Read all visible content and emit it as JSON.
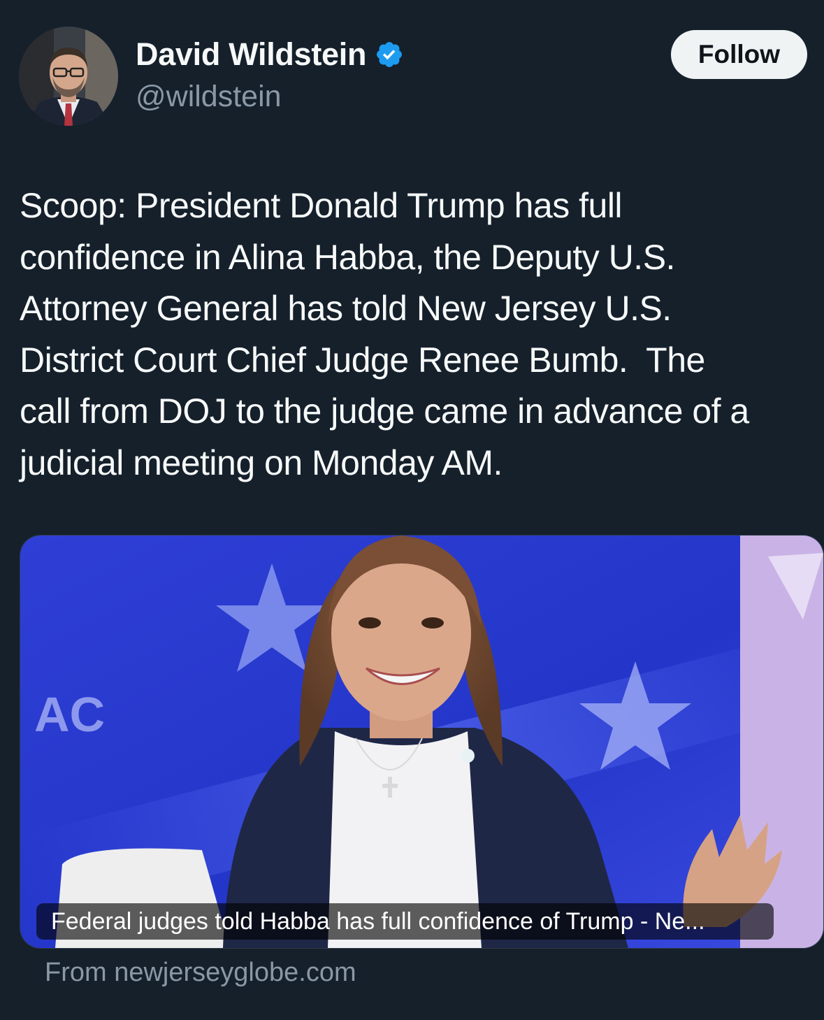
{
  "author": {
    "display_name": "David Wildstein",
    "handle": "@wildstein",
    "verified": true,
    "avatar_icon": "profile-photo"
  },
  "follow_button": {
    "label": "Follow"
  },
  "tweet": {
    "lines": [
      "Scoop: President Donald Trump has full",
      "confidence in Alina Habba, the Deputy U.S.",
      "Attorney General has told New Jersey U.S.",
      "District Court Chief Judge Renee Bumb.  The",
      "call from DOJ to the judge came in advance of a",
      "judicial meeting on Monday AM."
    ]
  },
  "link_card": {
    "title": "Federal judges told Habba has full confidence of Trump - Ne...",
    "source": "From newjerseyglobe.com",
    "image_icon": "article-photo"
  },
  "colors": {
    "background": "#15202b",
    "text_primary": "#f7f9f9",
    "text_secondary": "#8b98a5",
    "verified_blue": "#1d9bf0",
    "follow_bg": "#eff3f4"
  }
}
